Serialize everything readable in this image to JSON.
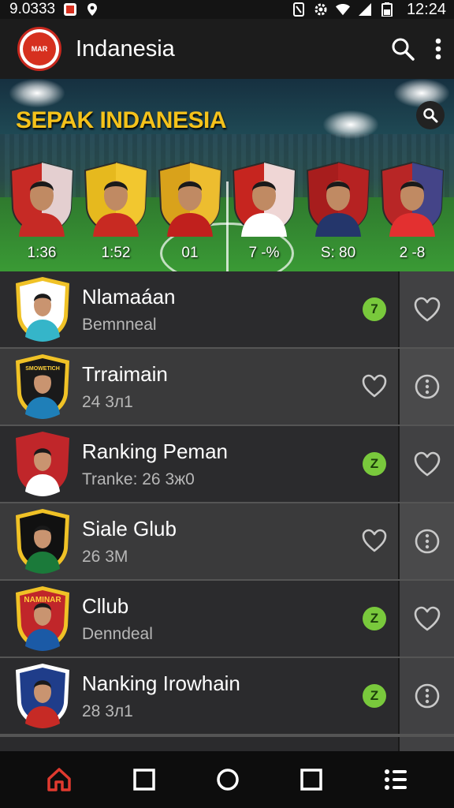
{
  "status_bar": {
    "left_text": "9.0333",
    "time": "12:24",
    "icons": [
      "notification-badge-icon",
      "location-icon",
      "nfc-icon",
      "settings-icon",
      "wifi-icon",
      "signal-icon",
      "battery-icon"
    ]
  },
  "app_bar": {
    "logo_text": "MAR",
    "title": "Indanesia",
    "actions": [
      "search-icon",
      "more-vert-icon"
    ]
  },
  "hero": {
    "title": "SEPAK INDANESIA",
    "players": [
      {
        "label": "1:36",
        "shield": "#c62a25",
        "shield_alt": "#e9ecef",
        "shirt": "#c62a25"
      },
      {
        "label": "1:52",
        "shield": "#e6b91e",
        "shield_alt": "#f3c933",
        "shirt": "#c82a22"
      },
      {
        "label": "01",
        "shield": "#d9a21b",
        "shield_alt": "#f0c232",
        "shirt": "#c0201d"
      },
      {
        "label": "7 -%",
        "shield": "#c6251f",
        "shield_alt": "#f6f6f6",
        "shirt": "#ffffff"
      },
      {
        "label": "S: 80",
        "shield": "#a71d1d",
        "shield_alt": "#b82323",
        "shirt": "#24366b"
      },
      {
        "label": "2 -8",
        "shield": "#b82626",
        "shield_alt": "#2f4a9a",
        "shirt": "#e33030"
      }
    ]
  },
  "list": [
    {
      "title": "Nlamaáan",
      "subtitle": "Bemnneal",
      "badge": "7",
      "side_icon": "heart-icon",
      "style": "normal",
      "crest": {
        "border": "#f0c226",
        "bg": "#ffffff",
        "shirt": "#35b5c9"
      }
    },
    {
      "title": "Trraimain",
      "subtitle": "24 3л1",
      "badge": "",
      "side_icon": "info-icon",
      "style": "alt",
      "crest": {
        "border": "#f0c226",
        "bg": "#1a1a1a",
        "shirt": "#1f7fb8"
      },
      "crest_text": "SMOWETICH"
    },
    {
      "title": "Ranking Peman",
      "subtitle": "Tranke: 26 3ж0",
      "badge": "Z",
      "side_icon": "heart-icon",
      "style": "normal",
      "crest": {
        "border": "#c0262a",
        "bg": "#c0262a",
        "shirt": "#ffffff"
      }
    },
    {
      "title": "Siale Glub",
      "subtitle": "26  3M",
      "badge": "",
      "side_icon": "info-icon",
      "style": "alt",
      "crest": {
        "border": "#f0c226",
        "bg": "#111111",
        "shirt": "#1b7a3a"
      }
    },
    {
      "title": "Cllub",
      "subtitle": "Denndeal",
      "badge": "Z",
      "side_icon": "heart-icon",
      "style": "normal",
      "crest": {
        "border": "#f0c226",
        "bg": "#c0262a",
        "shirt": "#1b5aa6"
      },
      "crest_text": "NAMINAR"
    },
    {
      "title": "Nanking Irowhain",
      "subtitle": "28 3л1",
      "badge": "Z",
      "side_icon": "info-icon",
      "style": "normal",
      "crest": {
        "border": "#ffffff",
        "bg": "#1f3d8a",
        "shirt": "#c62a25"
      }
    }
  ],
  "nav_bar": {
    "items": [
      "home-icon",
      "square-icon",
      "circle-icon",
      "square-icon",
      "menu-icon"
    ],
    "active_color": "#e03a2f"
  }
}
